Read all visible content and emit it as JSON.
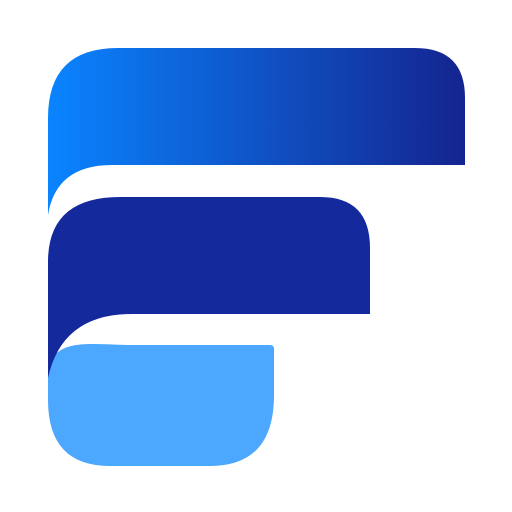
{
  "logo": {
    "icon": "letter-f-logo-icon",
    "colors": {
      "top_gradient_start": "#0A84FF",
      "top_gradient_end": "#14248F",
      "middle_bar": "#14299B",
      "bottom_bar": "#4CA8FF",
      "background": "#FFFFFF"
    }
  }
}
